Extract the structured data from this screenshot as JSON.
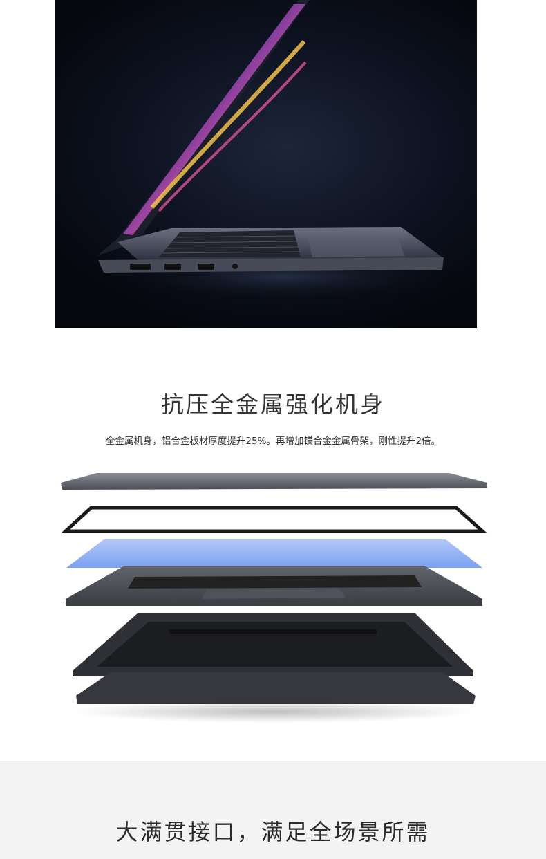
{
  "colors": {
    "hero_background": "#0b101c",
    "heading_text": "#333333",
    "section2_background": "#f3f3f3",
    "glass_layer": "#7aa0f0",
    "chassis": "#3a3c42"
  },
  "hero": {
    "image": "laptop-side-profile-image"
  },
  "strength_section": {
    "title": "抗压全金属强化机身",
    "description": "全金属机身，铝合金板材厚度提升25%。再增加镁合金金属骨架，刚性提升2倍。"
  },
  "ports_section": {
    "title": "大满贯接口，满足全场景所需"
  }
}
